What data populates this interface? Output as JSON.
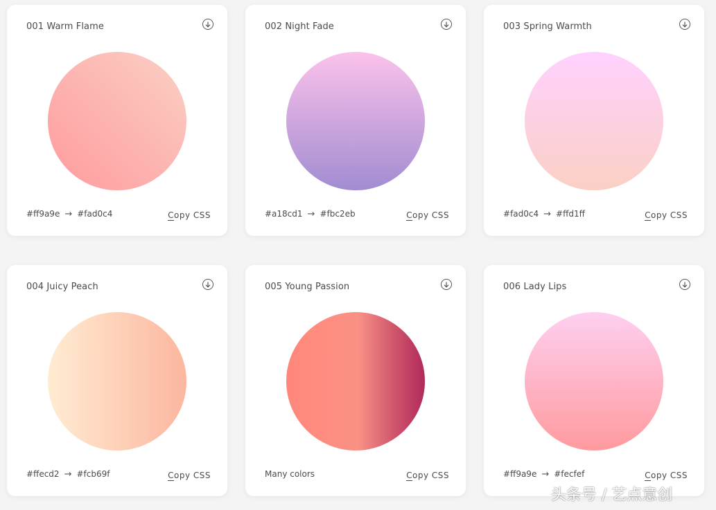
{
  "cards": [
    {
      "title": "001 Warm Flame",
      "from": "#ff9a9e",
      "arrow": "→",
      "to": "#fad0c4",
      "info": "",
      "copy_first": "C",
      "copy_rest": "opy CSS",
      "gradient": "linear-gradient(45deg, #ff9a9e 0%, #fad0c4 99%, #fad0c4 100%)"
    },
    {
      "title": "002 Night Fade",
      "from": "#a18cd1",
      "arrow": "→",
      "to": "#fbc2eb",
      "info": "",
      "copy_first": "C",
      "copy_rest": "opy CSS",
      "gradient": "linear-gradient(to top, #a18cd1 0%, #fbc2eb 100%)"
    },
    {
      "title": "003 Spring Warmth",
      "from": "#fad0c4",
      "arrow": "→",
      "to": "#ffd1ff",
      "info": "",
      "copy_first": "C",
      "copy_rest": "opy CSS",
      "gradient": "linear-gradient(to top, #fad0c4 0%, #ffd1ff 100%)"
    },
    {
      "title": "004 Juicy Peach",
      "from": "#ffecd2",
      "arrow": "→",
      "to": "#fcb69f",
      "info": "",
      "copy_first": "C",
      "copy_rest": "opy CSS",
      "gradient": "linear-gradient(to right, #ffecd2 0%, #fcb69f 100%)"
    },
    {
      "title": "005 Young Passion",
      "from": "",
      "arrow": "",
      "to": "",
      "info": "Many colors",
      "copy_first": "C",
      "copy_rest": "opy CSS",
      "gradient": "linear-gradient(to right, #ff8177 0%, #ff867a 0%, #ff8c7f 21%, #f99185 52%, #cf556c 78%, #b12a5b 100%)"
    },
    {
      "title": "006 Lady Lips",
      "from": "#ff9a9e",
      "arrow": "→",
      "to": "#fecfef",
      "info": "",
      "copy_first": "C",
      "copy_rest": "opy CSS",
      "gradient": "linear-gradient(to top, #ff9a9e 0%, #fecfef 99%, #fecfef 100%)"
    }
  ],
  "watermark": "头条号 / 艺点意创",
  "icons": {
    "download": "download-icon"
  }
}
